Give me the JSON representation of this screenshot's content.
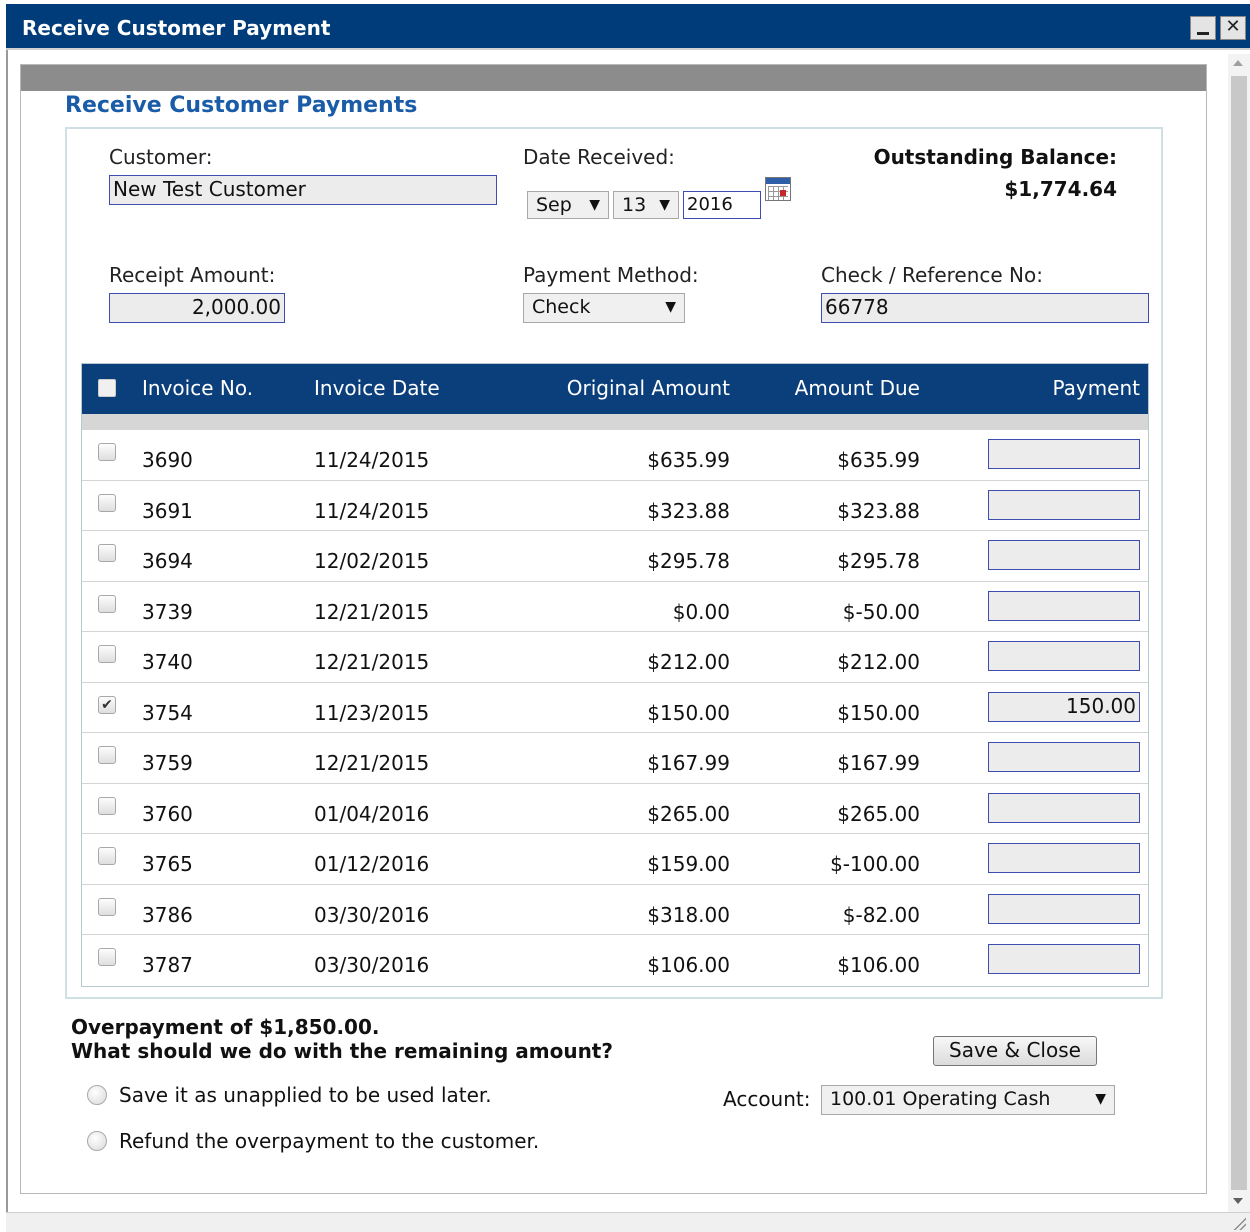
{
  "window": {
    "title": "Receive Customer Payment"
  },
  "form": {
    "heading": "Receive Customer Payments",
    "customer_label": "Customer:",
    "customer_value": "New Test Customer",
    "date_label": "Date Received:",
    "date_month": "Sep",
    "date_day": "13",
    "date_year": "2016",
    "balance_label": "Outstanding Balance:",
    "balance_value": "$1,774.64",
    "receipt_label": "Receipt Amount:",
    "receipt_value": "2,000.00",
    "method_label": "Payment Method:",
    "method_value": "Check",
    "reference_label": "Check / Reference No:",
    "reference_value": "66778"
  },
  "table": {
    "headers": {
      "invoice_no": "Invoice No.",
      "invoice_date": "Invoice Date",
      "original_amount": "Original Amount",
      "amount_due": "Amount Due",
      "payment": "Payment"
    },
    "rows": [
      {
        "invoice_no": "3690",
        "date": "11/24/2015",
        "original": "$635.99",
        "due": "$635.99",
        "payment": "",
        "checked": false
      },
      {
        "invoice_no": "3691",
        "date": "11/24/2015",
        "original": "$323.88",
        "due": "$323.88",
        "payment": "",
        "checked": false
      },
      {
        "invoice_no": "3694",
        "date": "12/02/2015",
        "original": "$295.78",
        "due": "$295.78",
        "payment": "",
        "checked": false
      },
      {
        "invoice_no": "3739",
        "date": "12/21/2015",
        "original": "$0.00",
        "due": "$-50.00",
        "payment": "",
        "checked": false
      },
      {
        "invoice_no": "3740",
        "date": "12/21/2015",
        "original": "$212.00",
        "due": "$212.00",
        "payment": "",
        "checked": false
      },
      {
        "invoice_no": "3754",
        "date": "11/23/2015",
        "original": "$150.00",
        "due": "$150.00",
        "payment": "150.00",
        "checked": true
      },
      {
        "invoice_no": "3759",
        "date": "12/21/2015",
        "original": "$167.99",
        "due": "$167.99",
        "payment": "",
        "checked": false
      },
      {
        "invoice_no": "3760",
        "date": "01/04/2016",
        "original": "$265.00",
        "due": "$265.00",
        "payment": "",
        "checked": false
      },
      {
        "invoice_no": "3765",
        "date": "01/12/2016",
        "original": "$159.00",
        "due": "$-100.00",
        "payment": "",
        "checked": false
      },
      {
        "invoice_no": "3786",
        "date": "03/30/2016",
        "original": "$318.00",
        "due": "$-82.00",
        "payment": "",
        "checked": false
      },
      {
        "invoice_no": "3787",
        "date": "03/30/2016",
        "original": "$106.00",
        "due": "$106.00",
        "payment": "",
        "checked": false
      }
    ]
  },
  "overpayment": {
    "line1": "Overpayment of $1,850.00.",
    "line2": "What should we do with the remaining amount?",
    "option_unapplied": "Save it as unapplied to be used later.",
    "option_refund": "Refund the overpayment to the customer.",
    "account_label": "Account:",
    "account_value": "100.01 Operating Cash"
  },
  "actions": {
    "save_close": "Save & Close"
  },
  "colors": {
    "title_bar": "#003c7a",
    "table_header": "#0b3f7c",
    "heading": "#1a5ca8",
    "field_border": "#3e4db0"
  }
}
